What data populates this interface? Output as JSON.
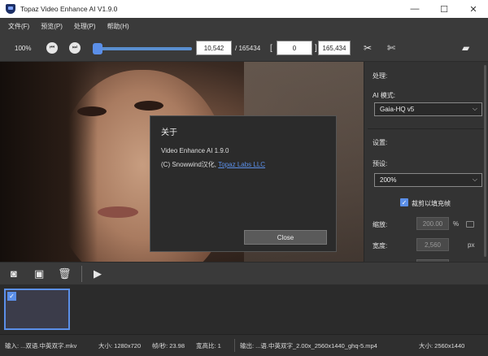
{
  "window": {
    "title": "Topaz Video Enhance AI V1.9.0",
    "minimize": "—",
    "maximize": "☐",
    "close": "✕"
  },
  "menu": {
    "items": [
      "文件(F)",
      "预览(P)",
      "处理(P)",
      "帮助(H)"
    ]
  },
  "toolbar": {
    "zoom": "100%",
    "prev_icon": "skip-back-icon",
    "next_icon": "skip-forward-icon",
    "slider_position": 0.02,
    "current_frame": "10,542",
    "total_frames": "/ 165434",
    "range_open": "[",
    "range_start": "0",
    "range_close": "]",
    "range_end": "165,434",
    "icons": [
      "scissors-icon",
      "scissors-split-icon",
      "camera-icon"
    ]
  },
  "about_dialog": {
    "title": "关于",
    "version_line": "Video Enhance AI 1.9.0",
    "copyright_prefix": "(C) Snowwind汉化, ",
    "copyright_link": "Topaz Labs LLC",
    "close_label": "Close"
  },
  "right_panel": {
    "processing_label": "处理:",
    "ai_model_label": "AI 模式:",
    "ai_model_value": "Gaia-HQ v5",
    "settings_label": "设置:",
    "preset_label": "预设:",
    "preset_value": "200%",
    "crop_fill_label": "裁剪以填充帧",
    "crop_fill_checked": true,
    "scale_label": "缩放:",
    "scale_value": "200.00",
    "scale_unit": "%",
    "width_label": "宽度:",
    "width_value": "2,560",
    "width_unit": "px"
  },
  "bottom_toolbar": {
    "icons": [
      "add-camera-icon",
      "camera-remove-icon",
      "trash-icon",
      "video-export-icon"
    ]
  },
  "thumbnail": {
    "selected": true
  },
  "statusbar": {
    "input": "输入: ...双语.中英双字.mkv",
    "size": "大小: 1280x720",
    "fps": "帧/秒: 23.98",
    "aspect": "宽高比: 1",
    "output": "输出: ...语.中英双字_2.00x_2560x1440_ghq-5.mp4",
    "output_size": "大小: 2560x1440"
  }
}
